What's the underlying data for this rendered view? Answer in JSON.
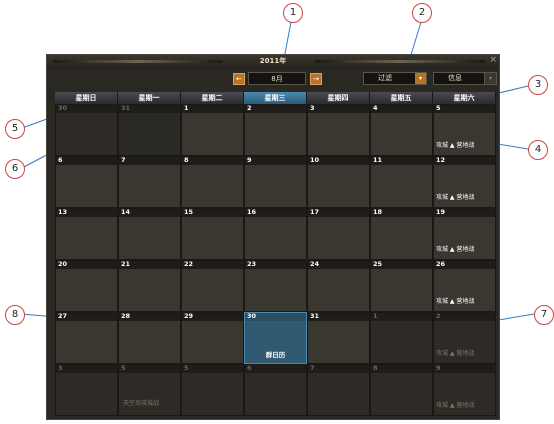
{
  "window": {
    "year": "2011年",
    "close_glyph": "×",
    "prev_glyph": "←",
    "next_glyph": "→",
    "month": "8月",
    "filter_label": "过滤",
    "info_label": "信息",
    "dropdown_glyph": "▾"
  },
  "weekdays": [
    "星期日",
    "星期一",
    "星期二",
    "星期三",
    "星期四",
    "星期五",
    "星期六"
  ],
  "weeks": [
    [
      {
        "n": "30",
        "dim": true
      },
      {
        "n": "31",
        "dim": true
      },
      {
        "n": "1"
      },
      {
        "n": "2"
      },
      {
        "n": "3"
      },
      {
        "n": "4"
      },
      {
        "n": "5",
        "event": "攻城 ▲ 营地战"
      }
    ],
    [
      {
        "n": "6"
      },
      {
        "n": "7"
      },
      {
        "n": "8"
      },
      {
        "n": "9"
      },
      {
        "n": "10"
      },
      {
        "n": "11"
      },
      {
        "n": "12",
        "event": "攻城 ▲ 营地战"
      }
    ],
    [
      {
        "n": "13"
      },
      {
        "n": "14"
      },
      {
        "n": "15"
      },
      {
        "n": "16"
      },
      {
        "n": "17"
      },
      {
        "n": "18"
      },
      {
        "n": "19",
        "event": "攻城 ▲ 营地战"
      }
    ],
    [
      {
        "n": "20"
      },
      {
        "n": "21"
      },
      {
        "n": "22"
      },
      {
        "n": "23"
      },
      {
        "n": "24"
      },
      {
        "n": "25"
      },
      {
        "n": "26",
        "event": "攻城 ▲ 营地战"
      }
    ],
    [
      {
        "n": "27"
      },
      {
        "n": "28"
      },
      {
        "n": "29"
      },
      {
        "n": "30",
        "today": true,
        "event": "群日历"
      },
      {
        "n": "31"
      },
      {
        "n": "1",
        "dim": true
      },
      {
        "n": "2",
        "dim": true,
        "event": "攻城 ▲ 营地战"
      }
    ],
    [
      {
        "n": "3",
        "dim": true
      },
      {
        "n": "5",
        "dim": true,
        "event": "天空岛攻城战"
      },
      {
        "n": "5",
        "dim": true
      },
      {
        "n": "6",
        "dim": true
      },
      {
        "n": "7",
        "dim": true
      },
      {
        "n": "8",
        "dim": true
      },
      {
        "n": "9",
        "dim": true,
        "event": "攻城 ▲ 营地战"
      }
    ]
  ],
  "callouts": [
    "1",
    "2",
    "3",
    "4",
    "5",
    "6",
    "7",
    "8"
  ]
}
